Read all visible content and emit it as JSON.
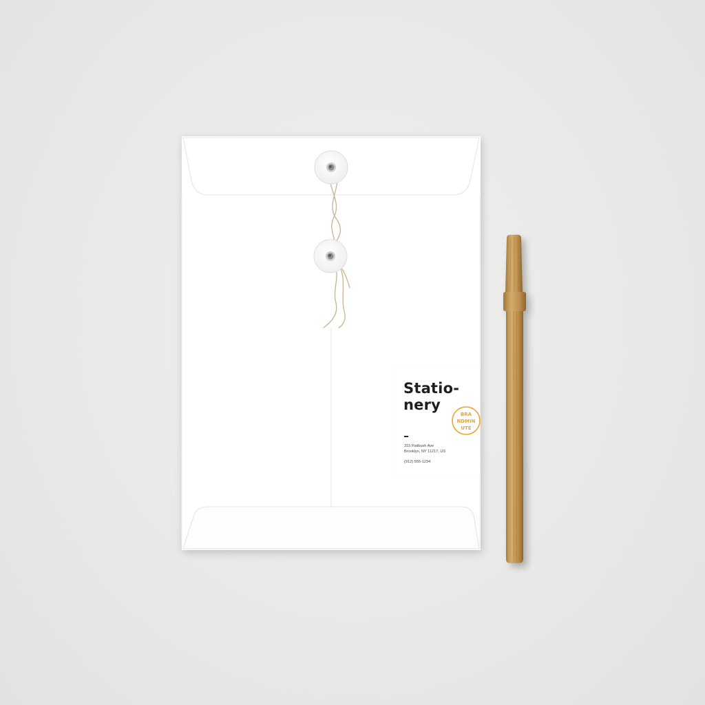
{
  "label": {
    "title_line1": "Statio-",
    "title_line2": "nery",
    "address_line1": "315 Flatbush Ave",
    "address_line2": "Brooklyn, NY 11217, US",
    "phone": "(912) 555-1234"
  },
  "stamp": {
    "line1": "BRA",
    "line2": "NDMIN",
    "line3": "UTE",
    "color": "#e6a72c"
  },
  "colors": {
    "background": "#e9e9e8",
    "envelope": "#ffffff",
    "pen": "#c79a5a",
    "string": "#c8b89a"
  }
}
